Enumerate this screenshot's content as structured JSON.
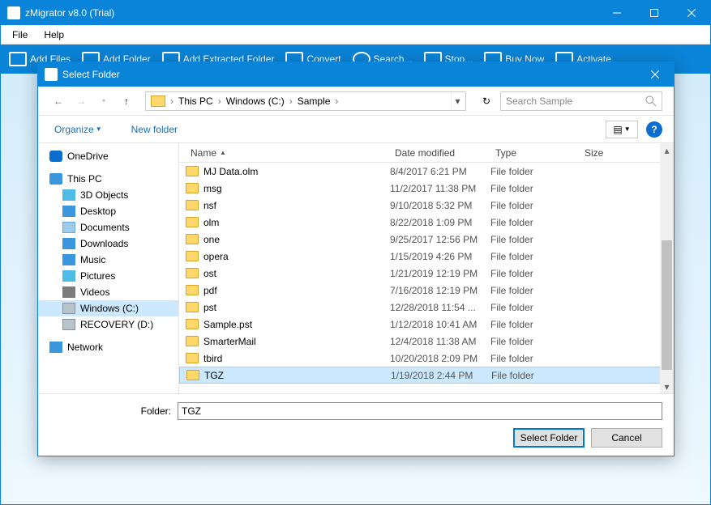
{
  "app": {
    "title": "zMigrator v8.0 (Trial)"
  },
  "menu": {
    "file": "File",
    "help": "Help"
  },
  "toolbar": {
    "add_files": "Add Files",
    "add_folder": "Add Folder",
    "add_extracted": "Add Extracted Folder",
    "convert": "Convert",
    "search": "Search...",
    "stop": "Stop...",
    "buy_now": "Buy Now",
    "activate": "Activate"
  },
  "dialog": {
    "title": "Select Folder",
    "breadcrumb": {
      "root": "This PC",
      "drive": "Windows (C:)",
      "folder": "Sample"
    },
    "search_placeholder": "Search Sample",
    "organize": "Organize",
    "new_folder": "New folder",
    "columns": {
      "name": "Name",
      "date": "Date modified",
      "type": "Type",
      "size": "Size"
    },
    "tree": {
      "onedrive": "OneDrive",
      "thispc": "This PC",
      "objects3d": "3D Objects",
      "desktop": "Desktop",
      "documents": "Documents",
      "downloads": "Downloads",
      "music": "Music",
      "pictures": "Pictures",
      "videos": "Videos",
      "windowsc": "Windows (C:)",
      "recovery": "RECOVERY (D:)",
      "network": "Network"
    },
    "files": [
      {
        "name": "MJ Data.olm",
        "date": "8/4/2017 6:21 PM",
        "type": "File folder"
      },
      {
        "name": "msg",
        "date": "11/2/2017 11:38 PM",
        "type": "File folder"
      },
      {
        "name": "nsf",
        "date": "9/10/2018 5:32 PM",
        "type": "File folder"
      },
      {
        "name": "olm",
        "date": "8/22/2018 1:09 PM",
        "type": "File folder"
      },
      {
        "name": "one",
        "date": "9/25/2017 12:56 PM",
        "type": "File folder"
      },
      {
        "name": "opera",
        "date": "1/15/2019 4:26 PM",
        "type": "File folder"
      },
      {
        "name": "ost",
        "date": "1/21/2019 12:19 PM",
        "type": "File folder"
      },
      {
        "name": "pdf",
        "date": "7/16/2018 12:19 PM",
        "type": "File folder"
      },
      {
        "name": "pst",
        "date": "12/28/2018 11:54 ...",
        "type": "File folder"
      },
      {
        "name": "Sample.pst",
        "date": "1/12/2018 10:41 AM",
        "type": "File folder"
      },
      {
        "name": "SmarterMail",
        "date": "12/4/2018 11:38 AM",
        "type": "File folder"
      },
      {
        "name": "tbird",
        "date": "10/20/2018 2:09 PM",
        "type": "File folder"
      },
      {
        "name": "TGZ",
        "date": "1/19/2018 2:44 PM",
        "type": "File folder",
        "selected": true
      }
    ],
    "folder_label": "Folder:",
    "folder_value": "TGZ",
    "select_btn": "Select Folder",
    "cancel_btn": "Cancel"
  }
}
